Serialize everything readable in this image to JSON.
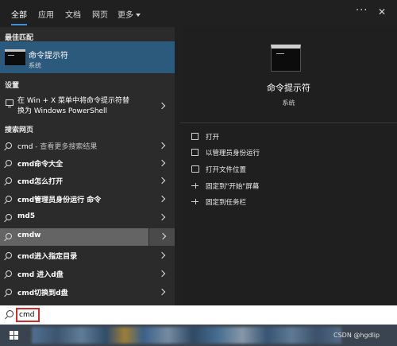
{
  "tabs": [
    {
      "label": "全部"
    },
    {
      "label": "应用"
    },
    {
      "label": "文档"
    },
    {
      "label": "网页"
    },
    {
      "label": "更多"
    }
  ],
  "sections": {
    "best_match": "最佳匹配",
    "settings": "设置",
    "web": "搜索网页"
  },
  "best_match": {
    "title": "命令提示符",
    "subtitle": "系统"
  },
  "settings_item": {
    "line1": "在 Win + X 菜单中将命令提示符替",
    "line2": "换为 Windows PowerShell"
  },
  "web_items": [
    {
      "text": "cmd",
      "suffix": " - 查看更多搜索结果"
    },
    {
      "text": "cmd命令大全",
      "suffix": ""
    },
    {
      "text": "cmd怎么打开",
      "suffix": ""
    },
    {
      "text": "cmd管理员身份运行 命令",
      "suffix": ""
    },
    {
      "text": "md5",
      "suffix": ""
    },
    {
      "text": "cmdw",
      "suffix": ""
    },
    {
      "text": "cmd进入指定目录",
      "suffix": ""
    },
    {
      "text": "cmd 进入d盘",
      "suffix": ""
    },
    {
      "text": "cmd切换到d盘",
      "suffix": ""
    }
  ],
  "preview": {
    "title": "命令提示符",
    "subtitle": "系统",
    "actions": [
      {
        "label": "打开",
        "icon": "open-icon"
      },
      {
        "label": "以管理员身份运行",
        "icon": "admin-run-icon"
      },
      {
        "label": "打开文件位置",
        "icon": "file-location-icon"
      },
      {
        "label": "固定到\"开始\"屏幕",
        "icon": "pin-icon"
      },
      {
        "label": "固定到任务栏",
        "icon": "pin-icon"
      }
    ]
  },
  "search": {
    "value": "cmd"
  },
  "watermark": "CSDN @hgdlip",
  "colors": {
    "selected_bg": "#2c5a7d",
    "hover_bg": "#646464",
    "accent": "#3d8fdb",
    "search_outline": "#d62a2a"
  }
}
